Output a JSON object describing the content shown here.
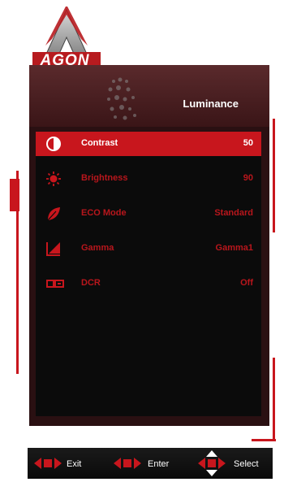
{
  "brand": {
    "logo_text": "AGON"
  },
  "panel": {
    "title": "Luminance"
  },
  "menu": [
    {
      "icon": "contrast-icon",
      "label": "Contrast",
      "value": "50",
      "active": true
    },
    {
      "icon": "brightness-icon",
      "label": "Brightness",
      "value": "90",
      "active": false
    },
    {
      "icon": "leaf-icon",
      "label": "ECO Mode",
      "value": "Standard",
      "active": false
    },
    {
      "icon": "gamma-icon",
      "label": "Gamma",
      "value": "Gamma1",
      "active": false
    },
    {
      "icon": "dcr-icon",
      "label": "DCR",
      "value": "Off",
      "active": false
    }
  ],
  "controls": {
    "exit_label": "Exit",
    "enter_label": "Enter",
    "select_label": "Select"
  },
  "colors": {
    "accent": "#c8161d",
    "panel": "#2a1012",
    "list_bg": "#0b0b0b"
  }
}
